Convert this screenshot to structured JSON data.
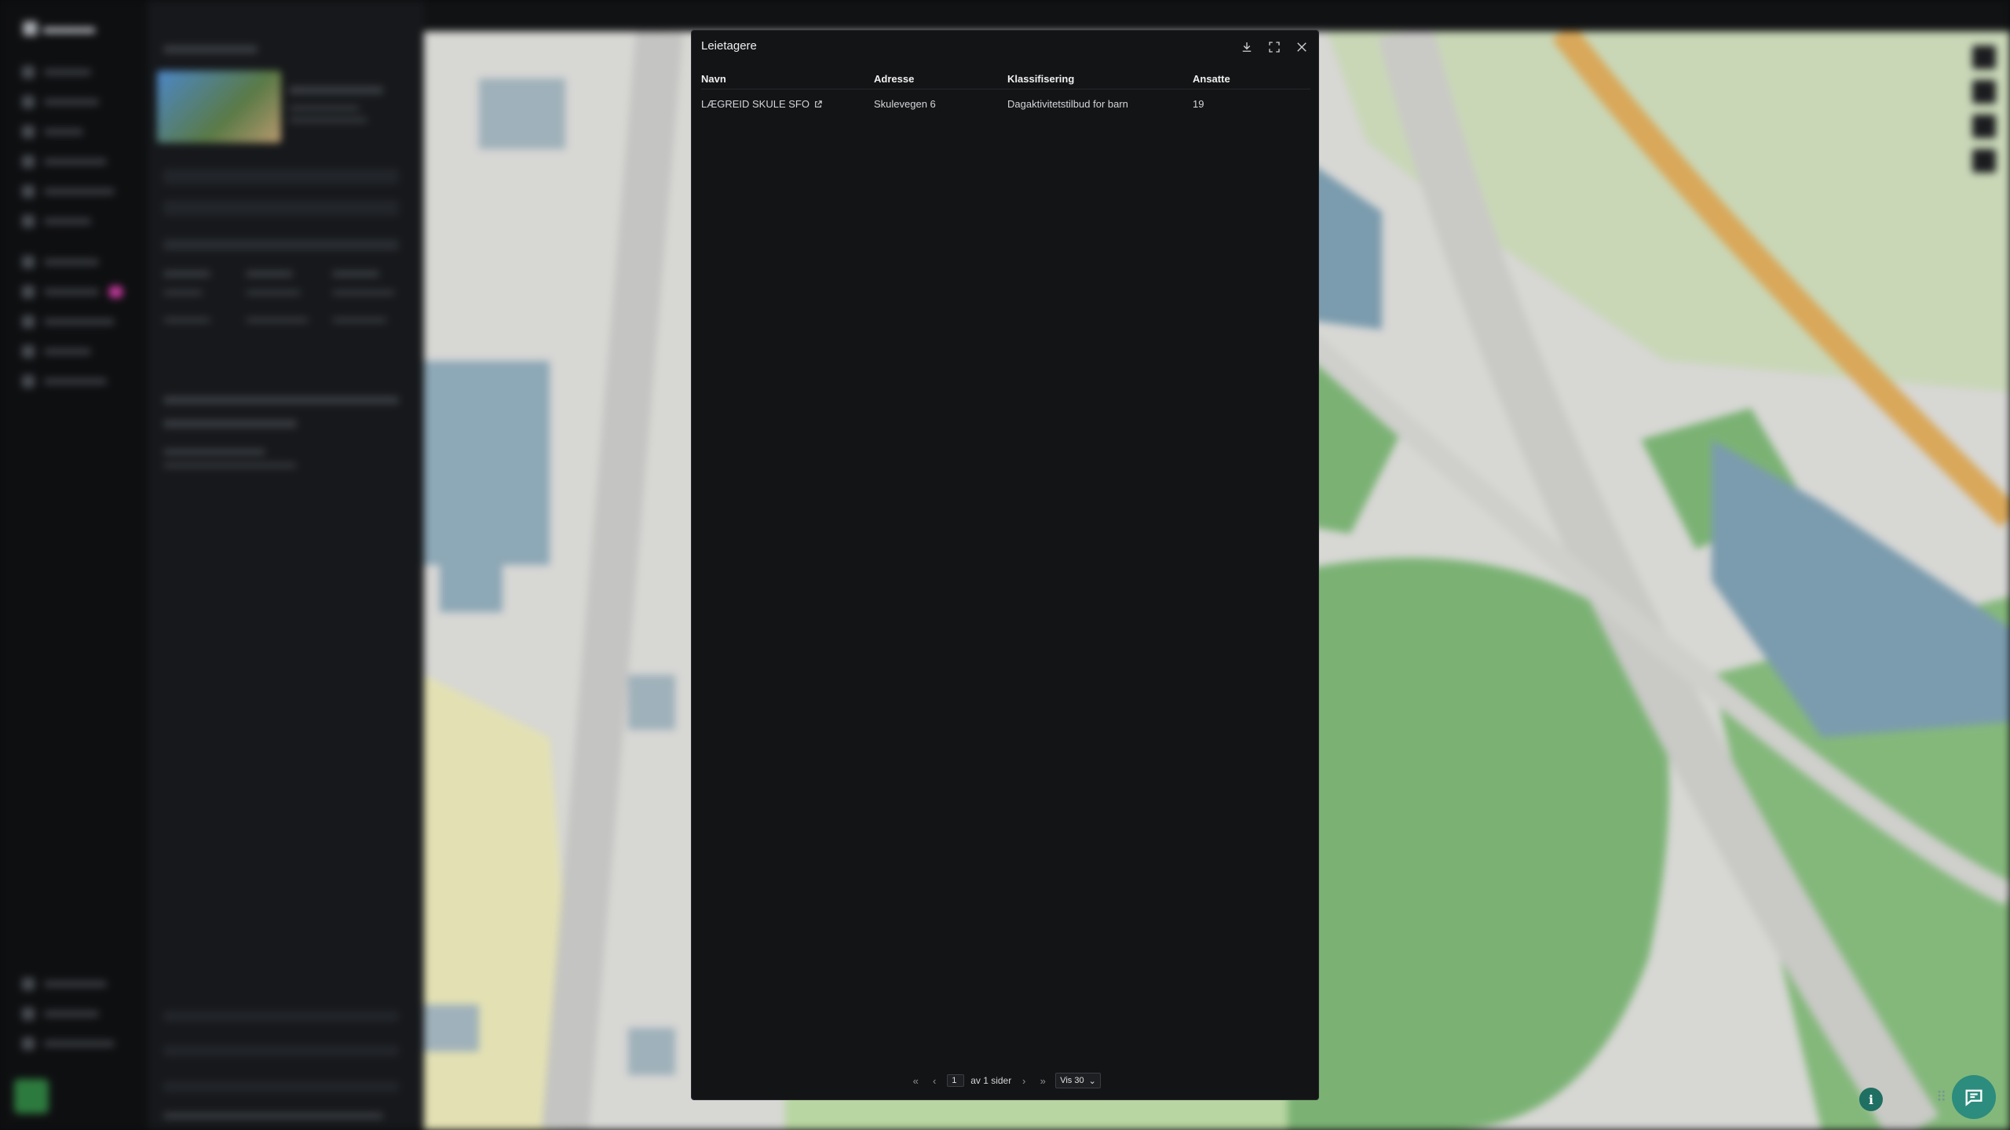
{
  "modal": {
    "title": "Leietagere",
    "columns": [
      "Navn",
      "Adresse",
      "Klassifisering",
      "Ansatte"
    ],
    "rows": [
      {
        "navn": "LÆGREID SKULE SFO",
        "adresse": "Skulevegen 6",
        "klassifisering": "Dagaktivitetstilbud for barn",
        "ansatte": "19"
      }
    ],
    "pagination": {
      "current_page": "1",
      "of_label": "av 1 sider",
      "page_size_label": "Vis 30"
    }
  },
  "icons": {
    "download": "download-icon",
    "fullscreen": "fullscreen-icon",
    "close": "close-icon",
    "external": "external-link-icon",
    "info": "info-icon",
    "chat": "chat-icon"
  },
  "floating": {
    "info_glyph": "i"
  },
  "colors": {
    "modal_bg": "#131416",
    "accent_teal": "#2c8c7d",
    "map_green": "#7bb274",
    "map_blue": "#7b9cae"
  }
}
